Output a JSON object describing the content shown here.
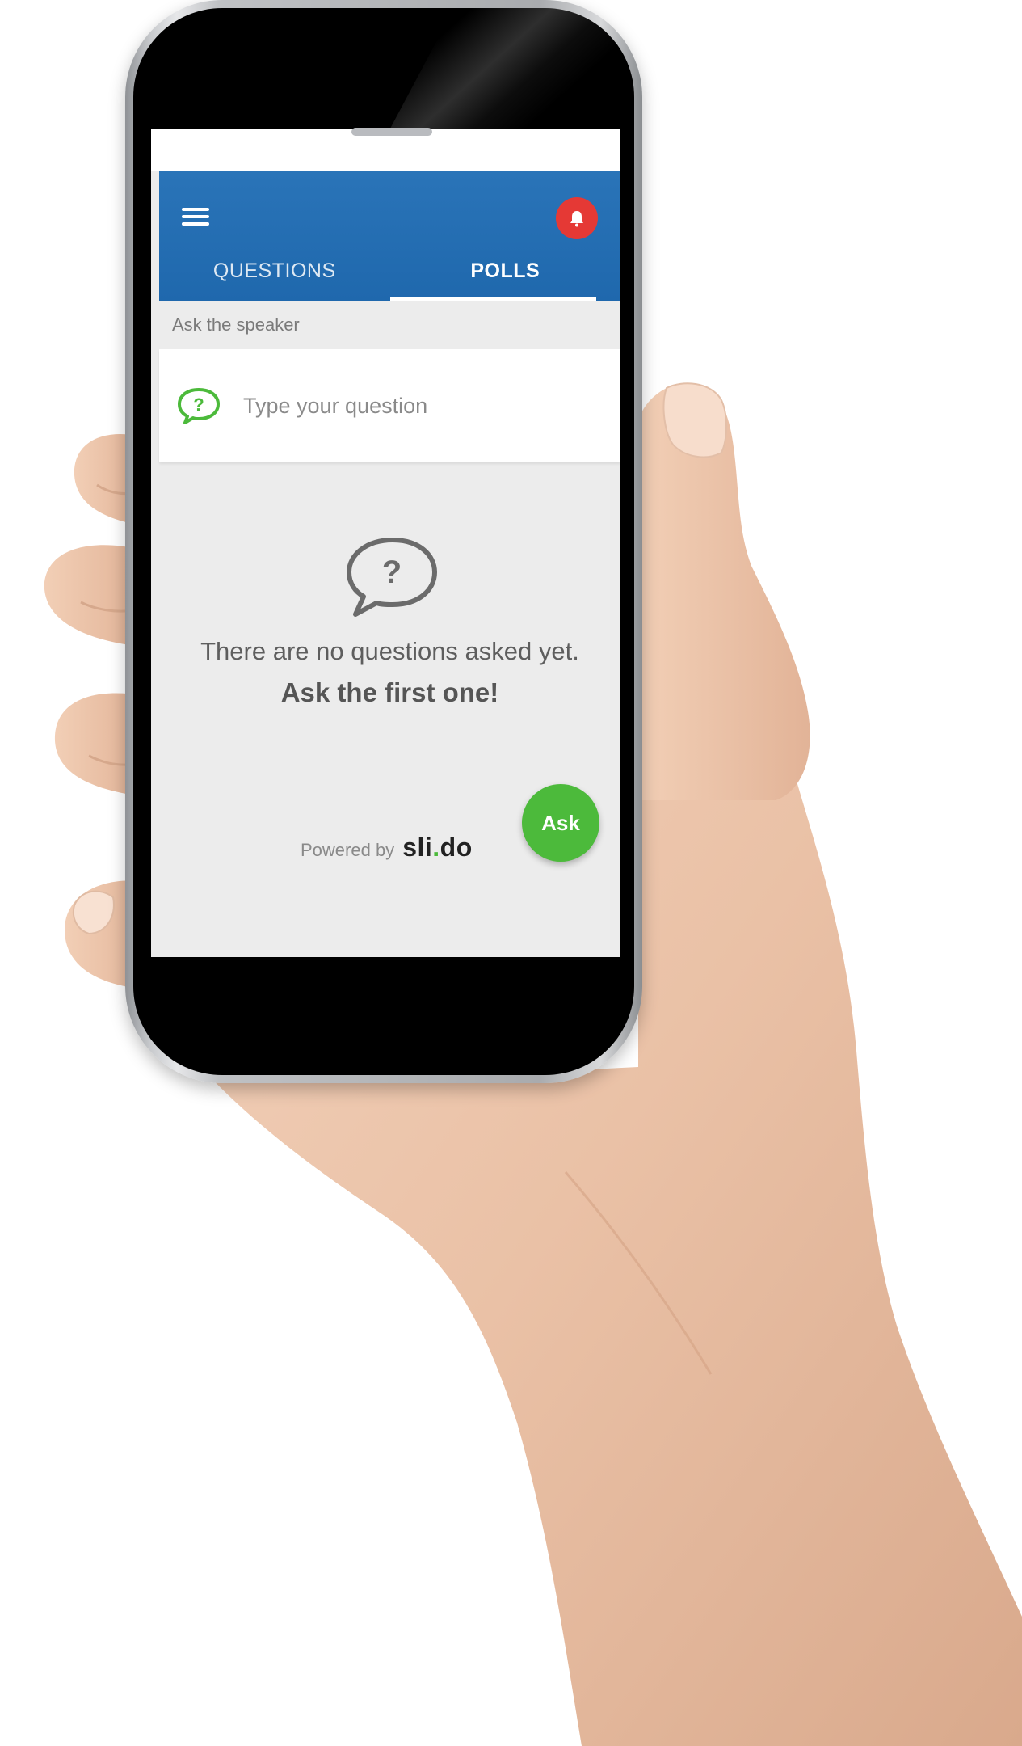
{
  "app": {
    "tabs": [
      {
        "label": "QUESTIONS",
        "active": false
      },
      {
        "label": "POLLS",
        "active": true
      }
    ],
    "notification_icon": "alert-bell-icon",
    "accent_blue": "#1f68ad",
    "accent_green": "#4cba3b",
    "alert_red": "#e53935"
  },
  "section": {
    "label": "Ask the speaker"
  },
  "question_input": {
    "placeholder": "Type your question"
  },
  "empty_state": {
    "line1": "There are no questions asked yet.",
    "line2": "Ask the first one!"
  },
  "fab": {
    "label": "Ask"
  },
  "footer": {
    "powered_by": "Powered by",
    "brand_left": "sli",
    "brand_dot": ".",
    "brand_right": "do"
  }
}
